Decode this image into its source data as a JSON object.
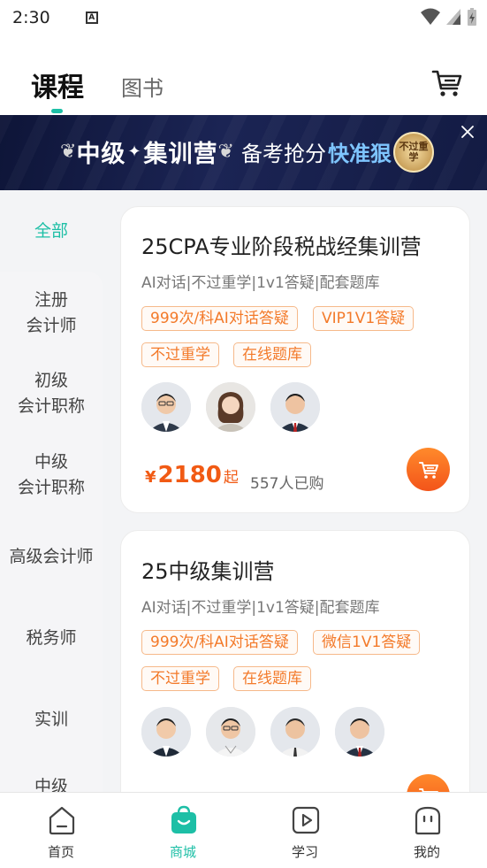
{
  "status_bar": {
    "time": "2:30",
    "notification_glyph": "A"
  },
  "top_tabs": {
    "items": [
      {
        "label": "课程",
        "active": true
      },
      {
        "label": "图书",
        "active": false
      }
    ],
    "cart_icon": "shopping-cart-icon"
  },
  "banner": {
    "title_left": "中级",
    "title_star": "✦",
    "title_right": "集训营",
    "subtitle": "备考抢分",
    "emphasis": "快准狠",
    "exclamation": "!",
    "seal_text": "不过重学",
    "accent_color": "#7ec5ff"
  },
  "sidebar": {
    "active_color": "#1dbfa6",
    "items": [
      {
        "label": "全部",
        "active": true
      },
      {
        "label": "注册\n会计师",
        "active": false
      },
      {
        "label": "初级\n会计职称",
        "active": false
      },
      {
        "label": "中级\n会计职称",
        "active": false
      },
      {
        "label": "高级会计师",
        "active": false
      },
      {
        "label": "税务师",
        "active": false
      },
      {
        "label": "实训",
        "active": false
      },
      {
        "label": "中级",
        "active": false
      }
    ]
  },
  "courses": [
    {
      "title": "25CPA专业阶段税战经集训营",
      "features": "AI对话|不过重学|1v1答疑|配套题库",
      "tags": [
        "999次/科AI对话答疑",
        "VIP1V1答疑",
        "不过重学",
        "在线题库"
      ],
      "teacher_count": 3,
      "price_currency": "¥",
      "price": "2180",
      "price_suffix": "起",
      "sold": "557人已购"
    },
    {
      "title": "25中级集训营",
      "features": "AI对话|不过重学|1v1答疑|配套题库",
      "tags": [
        "999次/科AI对话答疑",
        "微信1V1答疑",
        "不过重学",
        "在线题库"
      ],
      "teacher_count": 4
    }
  ],
  "bottom_nav": {
    "active_color": "#1dbfa6",
    "items": [
      {
        "label": "首页",
        "icon": "home-icon",
        "active": false
      },
      {
        "label": "商城",
        "icon": "mall-bag-icon",
        "active": true
      },
      {
        "label": "学习",
        "icon": "play-video-icon",
        "active": false
      },
      {
        "label": "我的",
        "icon": "profile-face-icon",
        "active": false
      }
    ]
  },
  "colors": {
    "accent": "#1dbfa6",
    "price": "#f15a14",
    "tag_border": "#f6b98a",
    "tag_text": "#f37a2a"
  }
}
